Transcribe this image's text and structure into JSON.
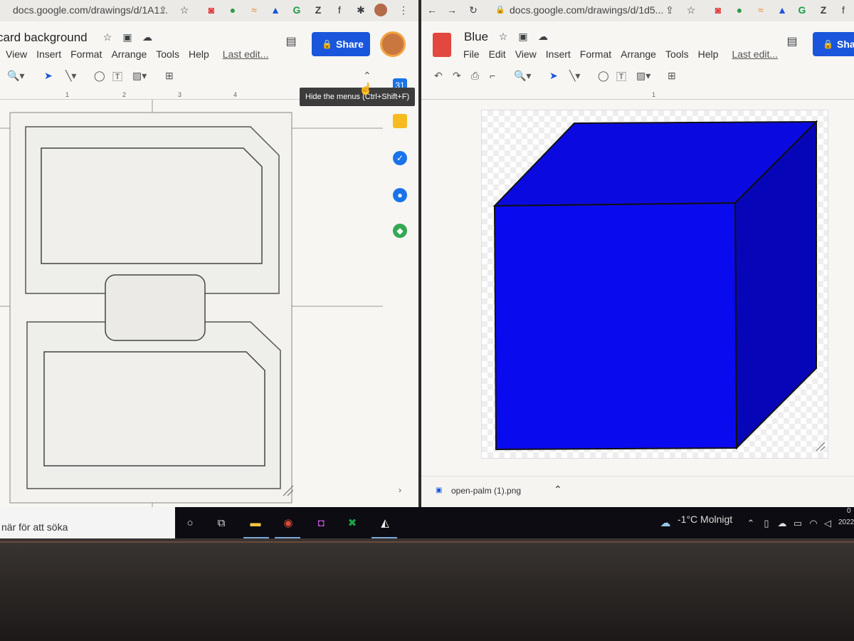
{
  "left_window": {
    "url": "docs.google.com/drawings/d/1A1...",
    "doc_title": "card background",
    "menu": [
      "View",
      "Insert",
      "Format",
      "Arrange",
      "Tools",
      "Help"
    ],
    "last_edit": "Last edit...",
    "share_label": "Share",
    "tooltip": "Hide the menus (Ctrl+Shift+F)",
    "ruler_marks": [
      "1",
      "2",
      "3",
      "4"
    ],
    "calendar_day": "31"
  },
  "right_window": {
    "url": "docs.google.com/drawings/d/1d5...",
    "doc_title": "Blue",
    "menu": [
      "File",
      "Edit",
      "View",
      "Insert",
      "Format",
      "Arrange",
      "Tools",
      "Help"
    ],
    "last_edit": "Last edit...",
    "share_label": "Shar",
    "ruler_marks": [
      "1"
    ],
    "download_file": "open-palm (1).png",
    "cube_colors": {
      "front": "#0a0aee",
      "top": "#0a0ae0",
      "side": "#0606b8"
    }
  },
  "taskbar": {
    "search_placeholder": "när för att söka",
    "weather": "-1°C  Molnigt",
    "clock_top": "0",
    "clock_bottom": "2022"
  }
}
